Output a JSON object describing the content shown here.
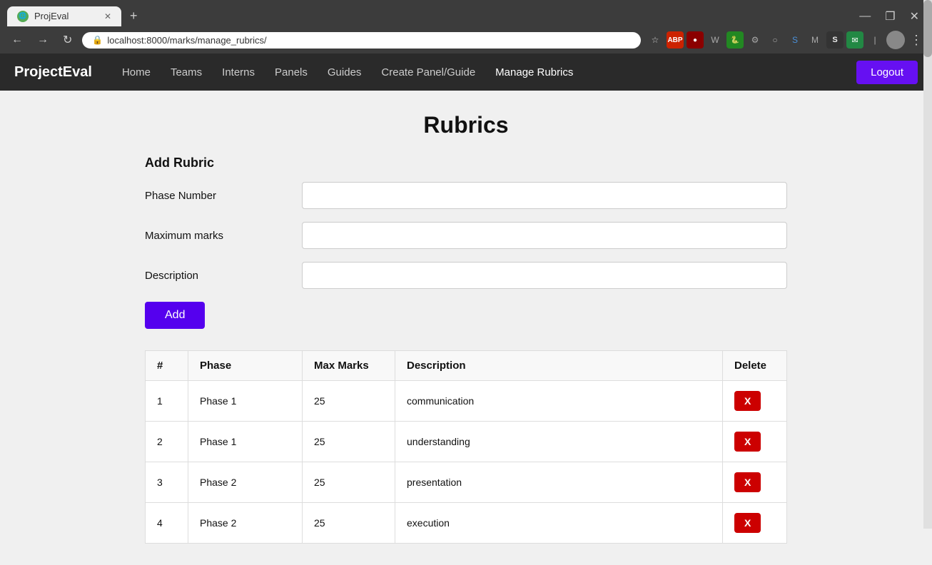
{
  "browser": {
    "tab_title": "ProjEval",
    "tab_favicon": "P",
    "url": "localhost:8000/marks/manage_rubrics/",
    "new_tab_label": "+",
    "win_minimize": "—",
    "win_maximize": "❐",
    "win_close": "✕",
    "nav_back": "←",
    "nav_forward": "→",
    "nav_reload": "↻",
    "star_icon": "☆"
  },
  "navbar": {
    "brand": "ProjectEval",
    "links": [
      {
        "label": "Home",
        "active": false
      },
      {
        "label": "Teams",
        "active": false
      },
      {
        "label": "Interns",
        "active": false
      },
      {
        "label": "Panels",
        "active": false
      },
      {
        "label": "Guides",
        "active": false
      },
      {
        "label": "Create Panel/Guide",
        "active": false
      },
      {
        "label": "Manage Rubrics",
        "active": true
      }
    ],
    "logout_label": "Logout"
  },
  "page": {
    "title": "Rubrics",
    "form": {
      "section_title": "Add Rubric",
      "fields": [
        {
          "label": "Phase Number",
          "placeholder": "",
          "name": "phase-number-input"
        },
        {
          "label": "Maximum marks",
          "placeholder": "",
          "name": "maximum-marks-input"
        },
        {
          "label": "Description",
          "placeholder": "",
          "name": "description-input"
        }
      ],
      "add_button": "Add"
    },
    "table": {
      "headers": [
        "#",
        "Phase",
        "Max Marks",
        "Description",
        "Delete"
      ],
      "rows": [
        {
          "num": "1",
          "phase": "Phase 1",
          "max_marks": "25",
          "description": "communication",
          "delete_label": "X"
        },
        {
          "num": "2",
          "phase": "Phase 1",
          "max_marks": "25",
          "description": "understanding",
          "delete_label": "X"
        },
        {
          "num": "3",
          "phase": "Phase 2",
          "max_marks": "25",
          "description": "presentation",
          "delete_label": "X"
        },
        {
          "num": "4",
          "phase": "Phase 2",
          "max_marks": "25",
          "description": "execution",
          "delete_label": "X"
        }
      ]
    }
  }
}
